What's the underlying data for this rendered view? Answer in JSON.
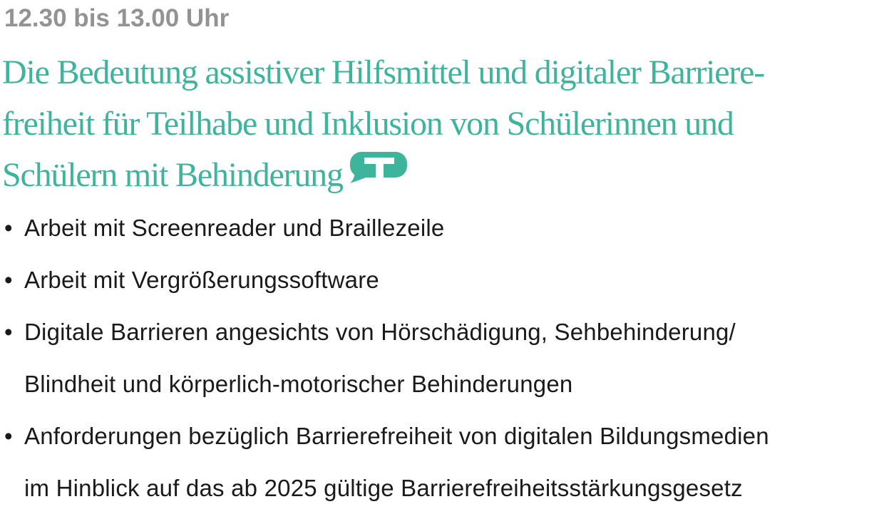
{
  "time": "12.30 bis 13.00 Uhr",
  "title": {
    "lines": [
      "Die Bedeutung assistiver Hilfsmittel und digitaler Barriere-",
      "freiheit für Teilhabe und Inklusion von Schülerinnen und",
      "Schülern mit Behinderung"
    ],
    "icon": "speech-bubble-t-icon"
  },
  "bullets": [
    {
      "lines": [
        "Arbeit mit Screenreader und Braillezeile"
      ]
    },
    {
      "lines": [
        "Arbeit mit Vergrößerungssoftware"
      ]
    },
    {
      "lines": [
        "Digitale Barrieren angesichts von Hörschädigung, Sehbehinderung/",
        "Blindheit und körperlich-motorischer Behinderungen"
      ]
    },
    {
      "lines": [
        "Anforderungen bezüglich Barrierefreiheit von digitalen Bildungsmedien",
        "im Hinblick auf das ab 2025 gültige Barrierefreiheitsstärkungsgesetz"
      ]
    }
  ],
  "bullet_symbol": "•",
  "colors": {
    "time": "#939393",
    "title": "#3fb49c",
    "body": "#1a1a1a"
  }
}
